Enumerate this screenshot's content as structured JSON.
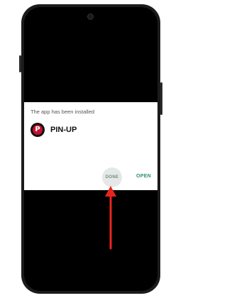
{
  "dialog": {
    "title": "The app has been installed",
    "app_name": "PIN-UP",
    "done_label": "DONE",
    "open_label": "OPEN"
  },
  "icons": {
    "app_icon": "pin-up-logo-icon",
    "annotation": "red-arrow-up-icon"
  },
  "colors": {
    "accent": "#2e8b74",
    "arrow": "#e8241f",
    "logo": "#c8102e"
  }
}
